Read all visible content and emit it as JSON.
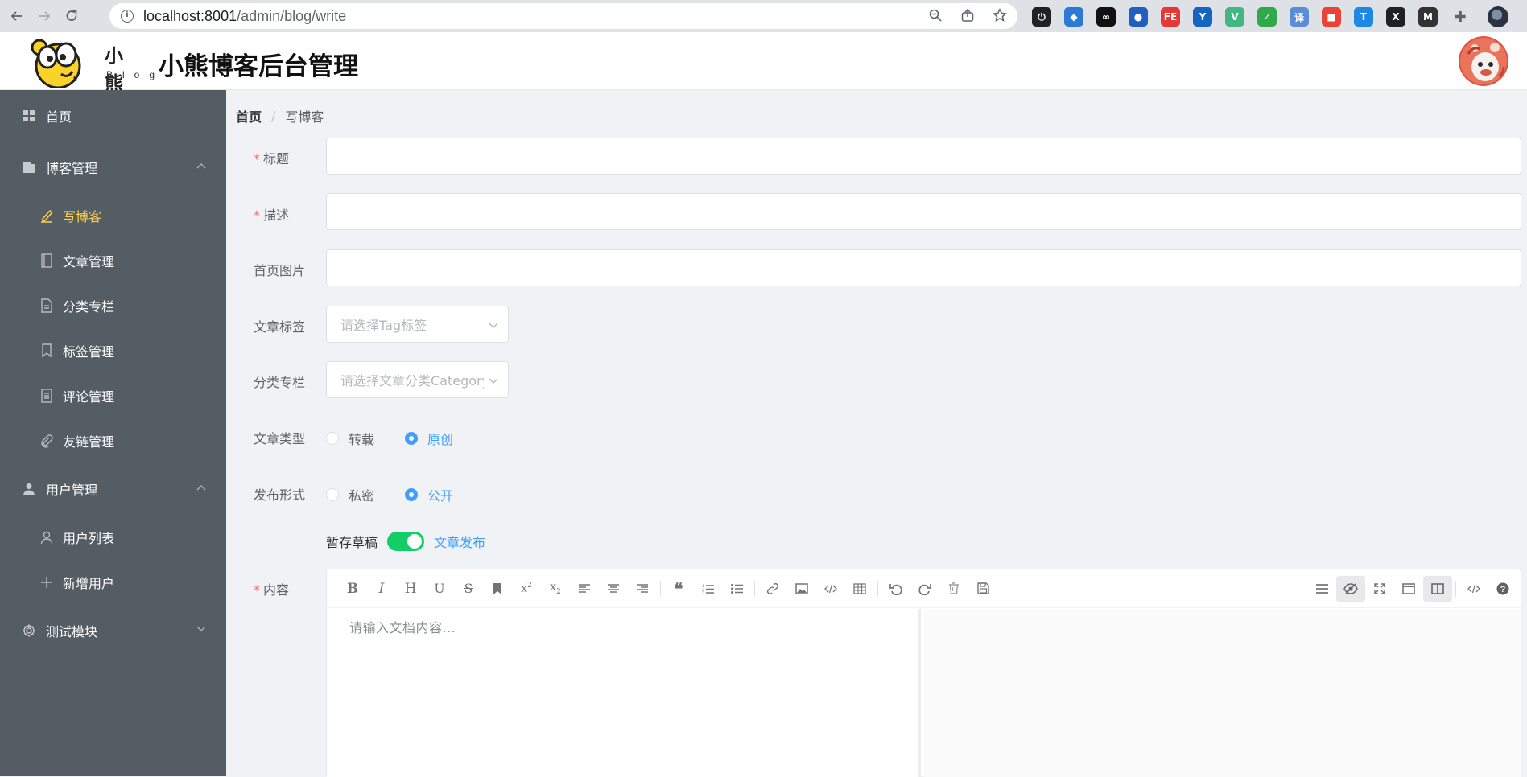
{
  "browser": {
    "url_host": "localhost:8001",
    "url_path": "/admin/blog/write",
    "extensions": [
      {
        "name": "power-extension-icon",
        "color": "#202124",
        "glyph": "⏻"
      },
      {
        "name": "shield-extension-icon",
        "color": "#2b7bd6",
        "glyph": "◆"
      },
      {
        "name": "infinity-extension-icon",
        "color": "#111111",
        "glyph": "∞"
      },
      {
        "name": "rocket-extension-icon",
        "color": "#1e5fbf",
        "glyph": "●"
      },
      {
        "name": "fe-extension-icon",
        "color": "#e53935",
        "glyph": "FE"
      },
      {
        "name": "y-extension-icon",
        "color": "#1565c0",
        "glyph": "Y"
      },
      {
        "name": "vue-devtools-icon",
        "color": "#41b883",
        "glyph": "V"
      },
      {
        "name": "shield-check-extension-icon",
        "color": "#2eaa4a",
        "glyph": "✓"
      },
      {
        "name": "translate-extension-icon",
        "color": "#5b8dd6",
        "glyph": "译"
      },
      {
        "name": "colorful-extension-icon",
        "color": "#ea4335",
        "glyph": "■"
      },
      {
        "name": "t-extension-icon",
        "color": "#1e88e5",
        "glyph": "T"
      },
      {
        "name": "x-extension-icon",
        "color": "#202124",
        "glyph": "X"
      },
      {
        "name": "muse-extension-icon",
        "color": "#333333",
        "glyph": "M"
      }
    ]
  },
  "header": {
    "logo_text": "小熊",
    "logo_sub": "Blog",
    "title": "小熊博客后台管理"
  },
  "sidebar": {
    "items": [
      {
        "label": "首页",
        "icon": "grid-icon"
      },
      {
        "label": "博客管理",
        "icon": "books-icon",
        "expanded": true,
        "children": [
          {
            "label": "写博客",
            "icon": "pen-icon",
            "active": true
          },
          {
            "label": "文章管理",
            "icon": "notebook-icon"
          },
          {
            "label": "分类专栏",
            "icon": "document-icon"
          },
          {
            "label": "标签管理",
            "icon": "bookmark-icon"
          },
          {
            "label": "评论管理",
            "icon": "tickets-icon"
          },
          {
            "label": "友链管理",
            "icon": "paperclip-icon"
          }
        ]
      },
      {
        "label": "用户管理",
        "icon": "user-filled-icon",
        "expanded": true,
        "children": [
          {
            "label": "用户列表",
            "icon": "user-icon"
          },
          {
            "label": "新增用户",
            "icon": "plus-icon"
          }
        ]
      },
      {
        "label": "测试模块",
        "icon": "gear-icon",
        "expanded": false
      }
    ],
    "active_color": "#ffd04b",
    "background": "#545c64"
  },
  "breadcrumb": {
    "home": "首页",
    "separator": "/",
    "current": "写博客"
  },
  "form": {
    "title_label": "标题",
    "desc_label": "描述",
    "image_label": "首页图片",
    "tag_label": "文章标签",
    "tag_placeholder": "请选择Tag标签",
    "category_label": "分类专栏",
    "category_placeholder": "请选择文章分类Category",
    "type_label": "文章类型",
    "type_options": [
      "转载",
      "原创"
    ],
    "type_selected": "原创",
    "publish_label": "发布形式",
    "publish_options": [
      "私密",
      "公开"
    ],
    "publish_selected": "公开",
    "draft_label": "暂存草稿",
    "publish_switch_label": "文章发布",
    "switch_on": true,
    "content_label": "内容",
    "required_mark": "*"
  },
  "editor": {
    "placeholder": "请输入文档内容...",
    "toolbar_left": [
      "bold-icon",
      "italic-icon",
      "header-icon",
      "underline-icon",
      "strikethrough-icon",
      "mark-icon",
      "superscript-icon",
      "subscript-icon",
      "align-left-icon",
      "align-center-icon",
      "align-right-icon",
      "|",
      "quote-icon",
      "ordered-list-icon",
      "unordered-list-icon",
      "|",
      "link-icon",
      "image-icon",
      "code-icon",
      "table-icon",
      "|",
      "undo-icon",
      "redo-icon",
      "trash-icon",
      "save-icon"
    ],
    "toolbar_right": [
      "navigation-icon",
      "preview-toggle-icon",
      "fullscreen-icon",
      "read-mode-icon",
      "subfield-icon",
      "|",
      "html-code-icon",
      "help-icon"
    ],
    "accent": "#409eff"
  }
}
